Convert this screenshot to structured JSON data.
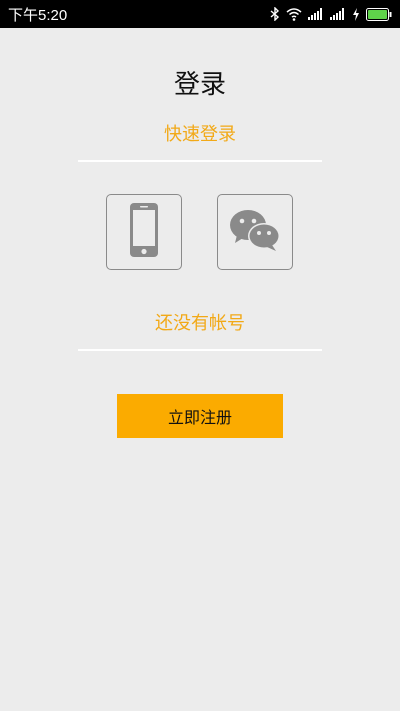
{
  "status_bar": {
    "time": "下午5:20",
    "icons": [
      "bluetooth-icon",
      "wifi-icon",
      "signal-icon",
      "signal-icon",
      "charging-icon",
      "battery-icon"
    ]
  },
  "page": {
    "title": "登录",
    "quick_login_label": "快速登录",
    "no_account_label": "还没有帐号",
    "register_button": "立即注册"
  },
  "login_options": [
    {
      "name": "phone-login",
      "icon": "phone-icon"
    },
    {
      "name": "wechat-login",
      "icon": "wechat-icon"
    }
  ],
  "colors": {
    "accent": "#f2a917",
    "button": "#fbab00",
    "background": "#ececec",
    "status_bar": "#000000"
  }
}
